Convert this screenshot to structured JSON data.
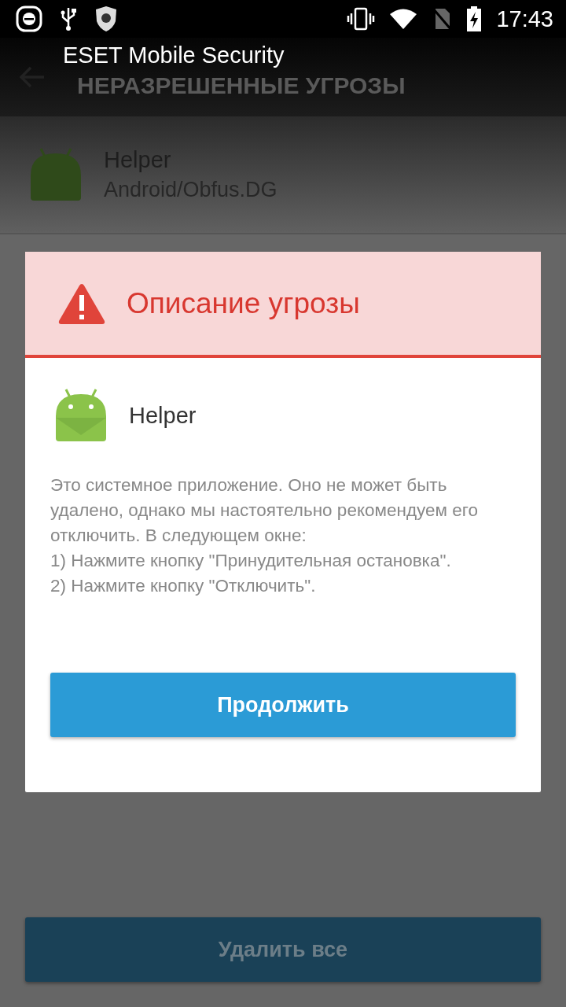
{
  "status_bar": {
    "time": "17:43"
  },
  "toast": {
    "text": "ESET Mobile Security"
  },
  "app_bar": {
    "title": "НЕРАЗРЕШЕННЫЕ УГРОЗЫ"
  },
  "threats": [
    {
      "name": "Helper",
      "detection": "Android/Obfus.DG"
    }
  ],
  "dialog": {
    "title": "Описание угрозы",
    "app_name": "Helper",
    "paragraphs": [
      "Это системное приложение. Оно не может быть удалено, однако мы настоятельно рекомендуем его отключить. В следующем окне:",
      "1) Нажмите кнопку \"Принудительная остановка\".",
      "2) Нажмите кнопку \"Отключить\"."
    ],
    "button": "Продолжить"
  },
  "bottom_button": "Удалить все"
}
